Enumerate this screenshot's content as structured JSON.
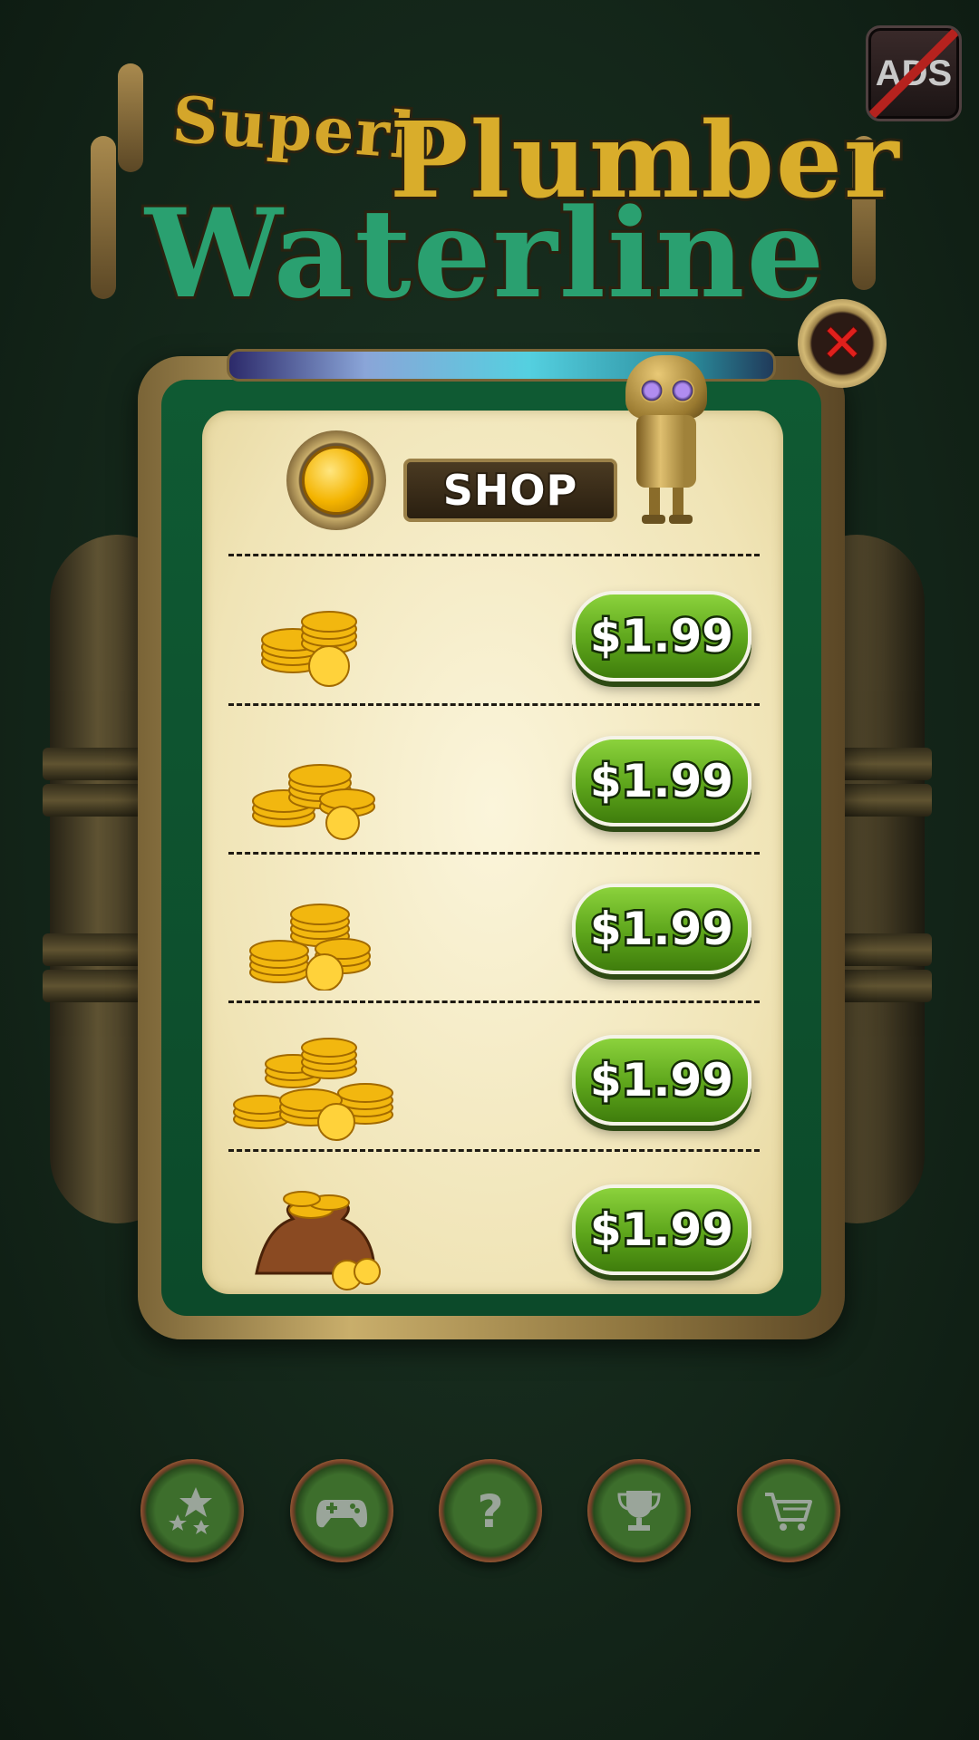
{
  "title": {
    "line1_a": "Superb",
    "line1_b": "Plumber",
    "line2": "Waterline"
  },
  "ads_button": {
    "label": "ADS",
    "icon": "no-ads-icon"
  },
  "close_button": {
    "icon": "close-icon",
    "glyph": "✕"
  },
  "shop": {
    "label": "SHOP",
    "header_icon": "coin-icon",
    "items": [
      {
        "icon": "small-coin-stack-icon",
        "price": "$1.99"
      },
      {
        "icon": "medium-coin-stack-icon",
        "price": "$1.99"
      },
      {
        "icon": "large-coin-stack-icon",
        "price": "$1.99"
      },
      {
        "icon": "coin-pile-icon",
        "price": "$1.99"
      },
      {
        "icon": "coin-bag-icon",
        "price": "$1.99"
      }
    ]
  },
  "bottom_nav": [
    {
      "icon": "stars-icon"
    },
    {
      "icon": "gamepad-icon"
    },
    {
      "icon": "help-icon"
    },
    {
      "icon": "trophy-icon"
    },
    {
      "icon": "cart-icon"
    }
  ],
  "colors": {
    "background": "#14271a",
    "price_button": "#5da51b",
    "close_x": "#e0201c",
    "panel": "#f3e9bd"
  }
}
